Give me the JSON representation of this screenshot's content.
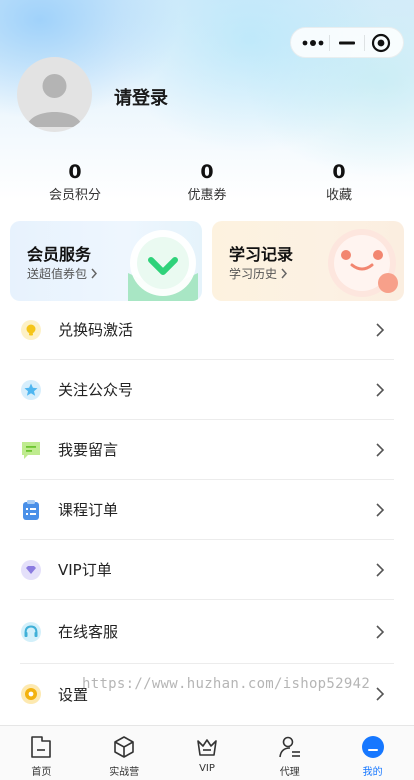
{
  "header": {
    "login_text": "请登录"
  },
  "stats": [
    {
      "value": "0",
      "label": "会员积分"
    },
    {
      "value": "0",
      "label": "优惠券"
    },
    {
      "value": "0",
      "label": "收藏"
    }
  ],
  "cards": {
    "member": {
      "title": "会员服务",
      "subtitle": "送超值券包"
    },
    "study": {
      "title": "学习记录",
      "subtitle": "学习历史"
    }
  },
  "menu": {
    "items": [
      {
        "label": "兑换码激活",
        "icon": "bulb-icon",
        "color": "#f5c518"
      },
      {
        "label": "关注公众号",
        "icon": "star-icon",
        "color": "#4fb6f0"
      },
      {
        "label": "我要留言",
        "icon": "message-icon",
        "color": "#8bd64a"
      },
      {
        "label": "课程订单",
        "icon": "clipboard-icon",
        "color": "#4a90e8"
      },
      {
        "label": "VIP订单",
        "icon": "vip-diamond-icon",
        "color": "#8a7be0"
      },
      {
        "label": "在线客服",
        "icon": "headset-icon",
        "color": "#3fb0d8"
      },
      {
        "label": "设置",
        "icon": "gear-icon",
        "color": "#f3b20e"
      }
    ]
  },
  "watermark": "https://www.huzhan.com/ishop52942",
  "tabbar": {
    "tabs": [
      {
        "label": "首页",
        "icon": "home-icon"
      },
      {
        "label": "实战营",
        "icon": "cube-icon"
      },
      {
        "label": "VIP",
        "icon": "crown-icon"
      },
      {
        "label": "代理",
        "icon": "agent-icon"
      },
      {
        "label": "我的",
        "icon": "profile-icon",
        "active": true
      }
    ],
    "active_color": "#1677ff"
  }
}
